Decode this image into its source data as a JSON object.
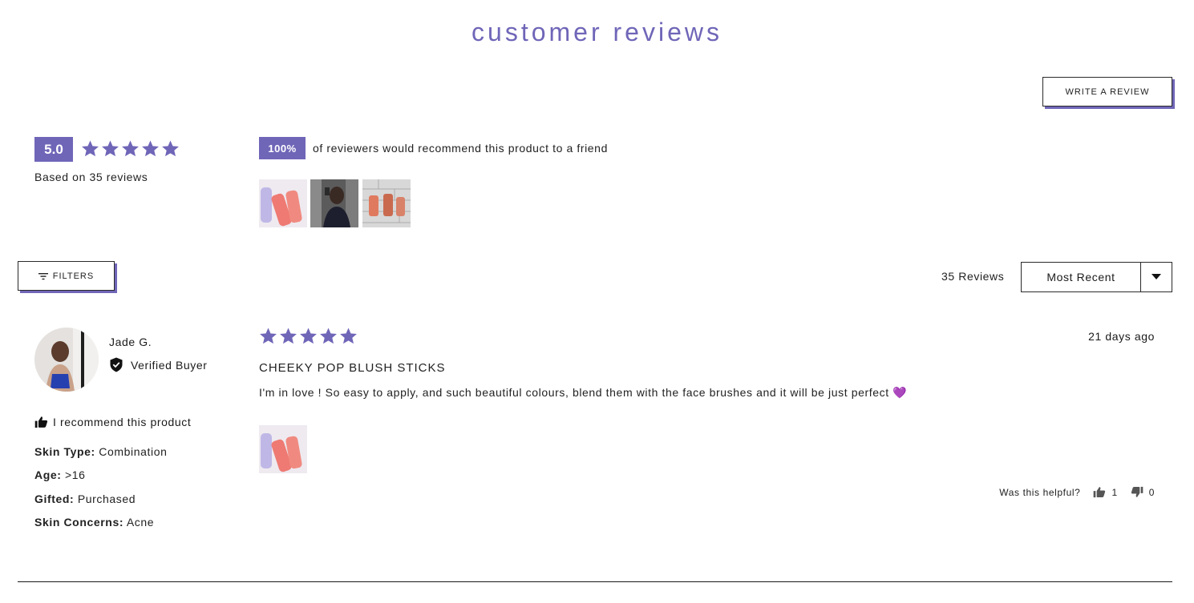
{
  "header": {
    "title": "customer reviews"
  },
  "actions": {
    "write_review": "WRITE A REVIEW",
    "filters": "FILTERS"
  },
  "summary": {
    "average_rating": "5.0",
    "star_rating": 5,
    "based_on": "Based on 35 reviews",
    "recommend_pct": "100%",
    "recommend_text": "of reviewers would recommend this product to a friend"
  },
  "toolbar": {
    "reviews_count": "35 Reviews",
    "sort_selected": "Most Recent"
  },
  "review": {
    "reviewer_name": "Jade G.",
    "verified_label": "Verified Buyer",
    "recommend_label": "I recommend this product",
    "attributes": [
      {
        "label": "Skin Type:",
        "value": "Combination"
      },
      {
        "label": "Age:",
        "value": ">16"
      },
      {
        "label": "Gifted:",
        "value": "Purchased"
      },
      {
        "label": "Skin Concerns:",
        "value": "Acne"
      }
    ],
    "rating": 5,
    "date": "21 days ago",
    "title": "CHEEKY POP BLUSH STICKS",
    "body": "I'm in love ! So easy to apply, and such beautiful colours, blend them with the face brushes and it will be just perfect 💜",
    "helpful_label": "Was this helpful?",
    "helpful_yes": "1",
    "helpful_no": "0"
  },
  "colors": {
    "accent": "#6f66b8",
    "border": "#2a2a2a"
  }
}
